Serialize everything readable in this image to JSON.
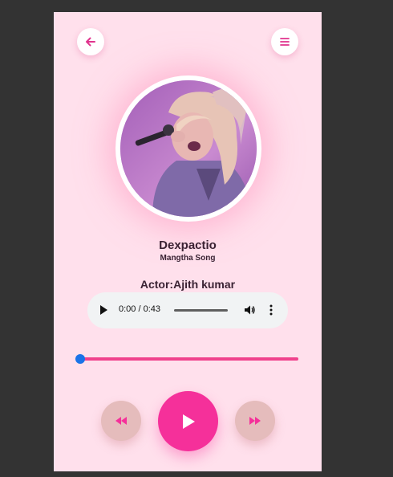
{
  "header": {
    "back_icon": "arrow-left-icon",
    "menu_icon": "hamburger-menu-icon",
    "accent": "#e0338d"
  },
  "song": {
    "title": "Dexpactio",
    "subtitle": "Mangtha Song",
    "actor": "Actor:Ajith kumar",
    "cover_alt": "singer with microphone"
  },
  "audio": {
    "time": "0:00 / 0:43",
    "play_icon": "play-icon",
    "volume_icon": "volume-icon",
    "more_icon": "more-vertical-icon"
  },
  "progress": {
    "value": 0,
    "track_color": "#f0418c",
    "thumb_color": "#1a73e8"
  },
  "controls": {
    "prev_icon": "rewind-icon",
    "play_icon": "play-icon",
    "next_icon": "fast-forward-icon",
    "play_color": "#f5309a",
    "side_color": "#e5bcbc"
  }
}
